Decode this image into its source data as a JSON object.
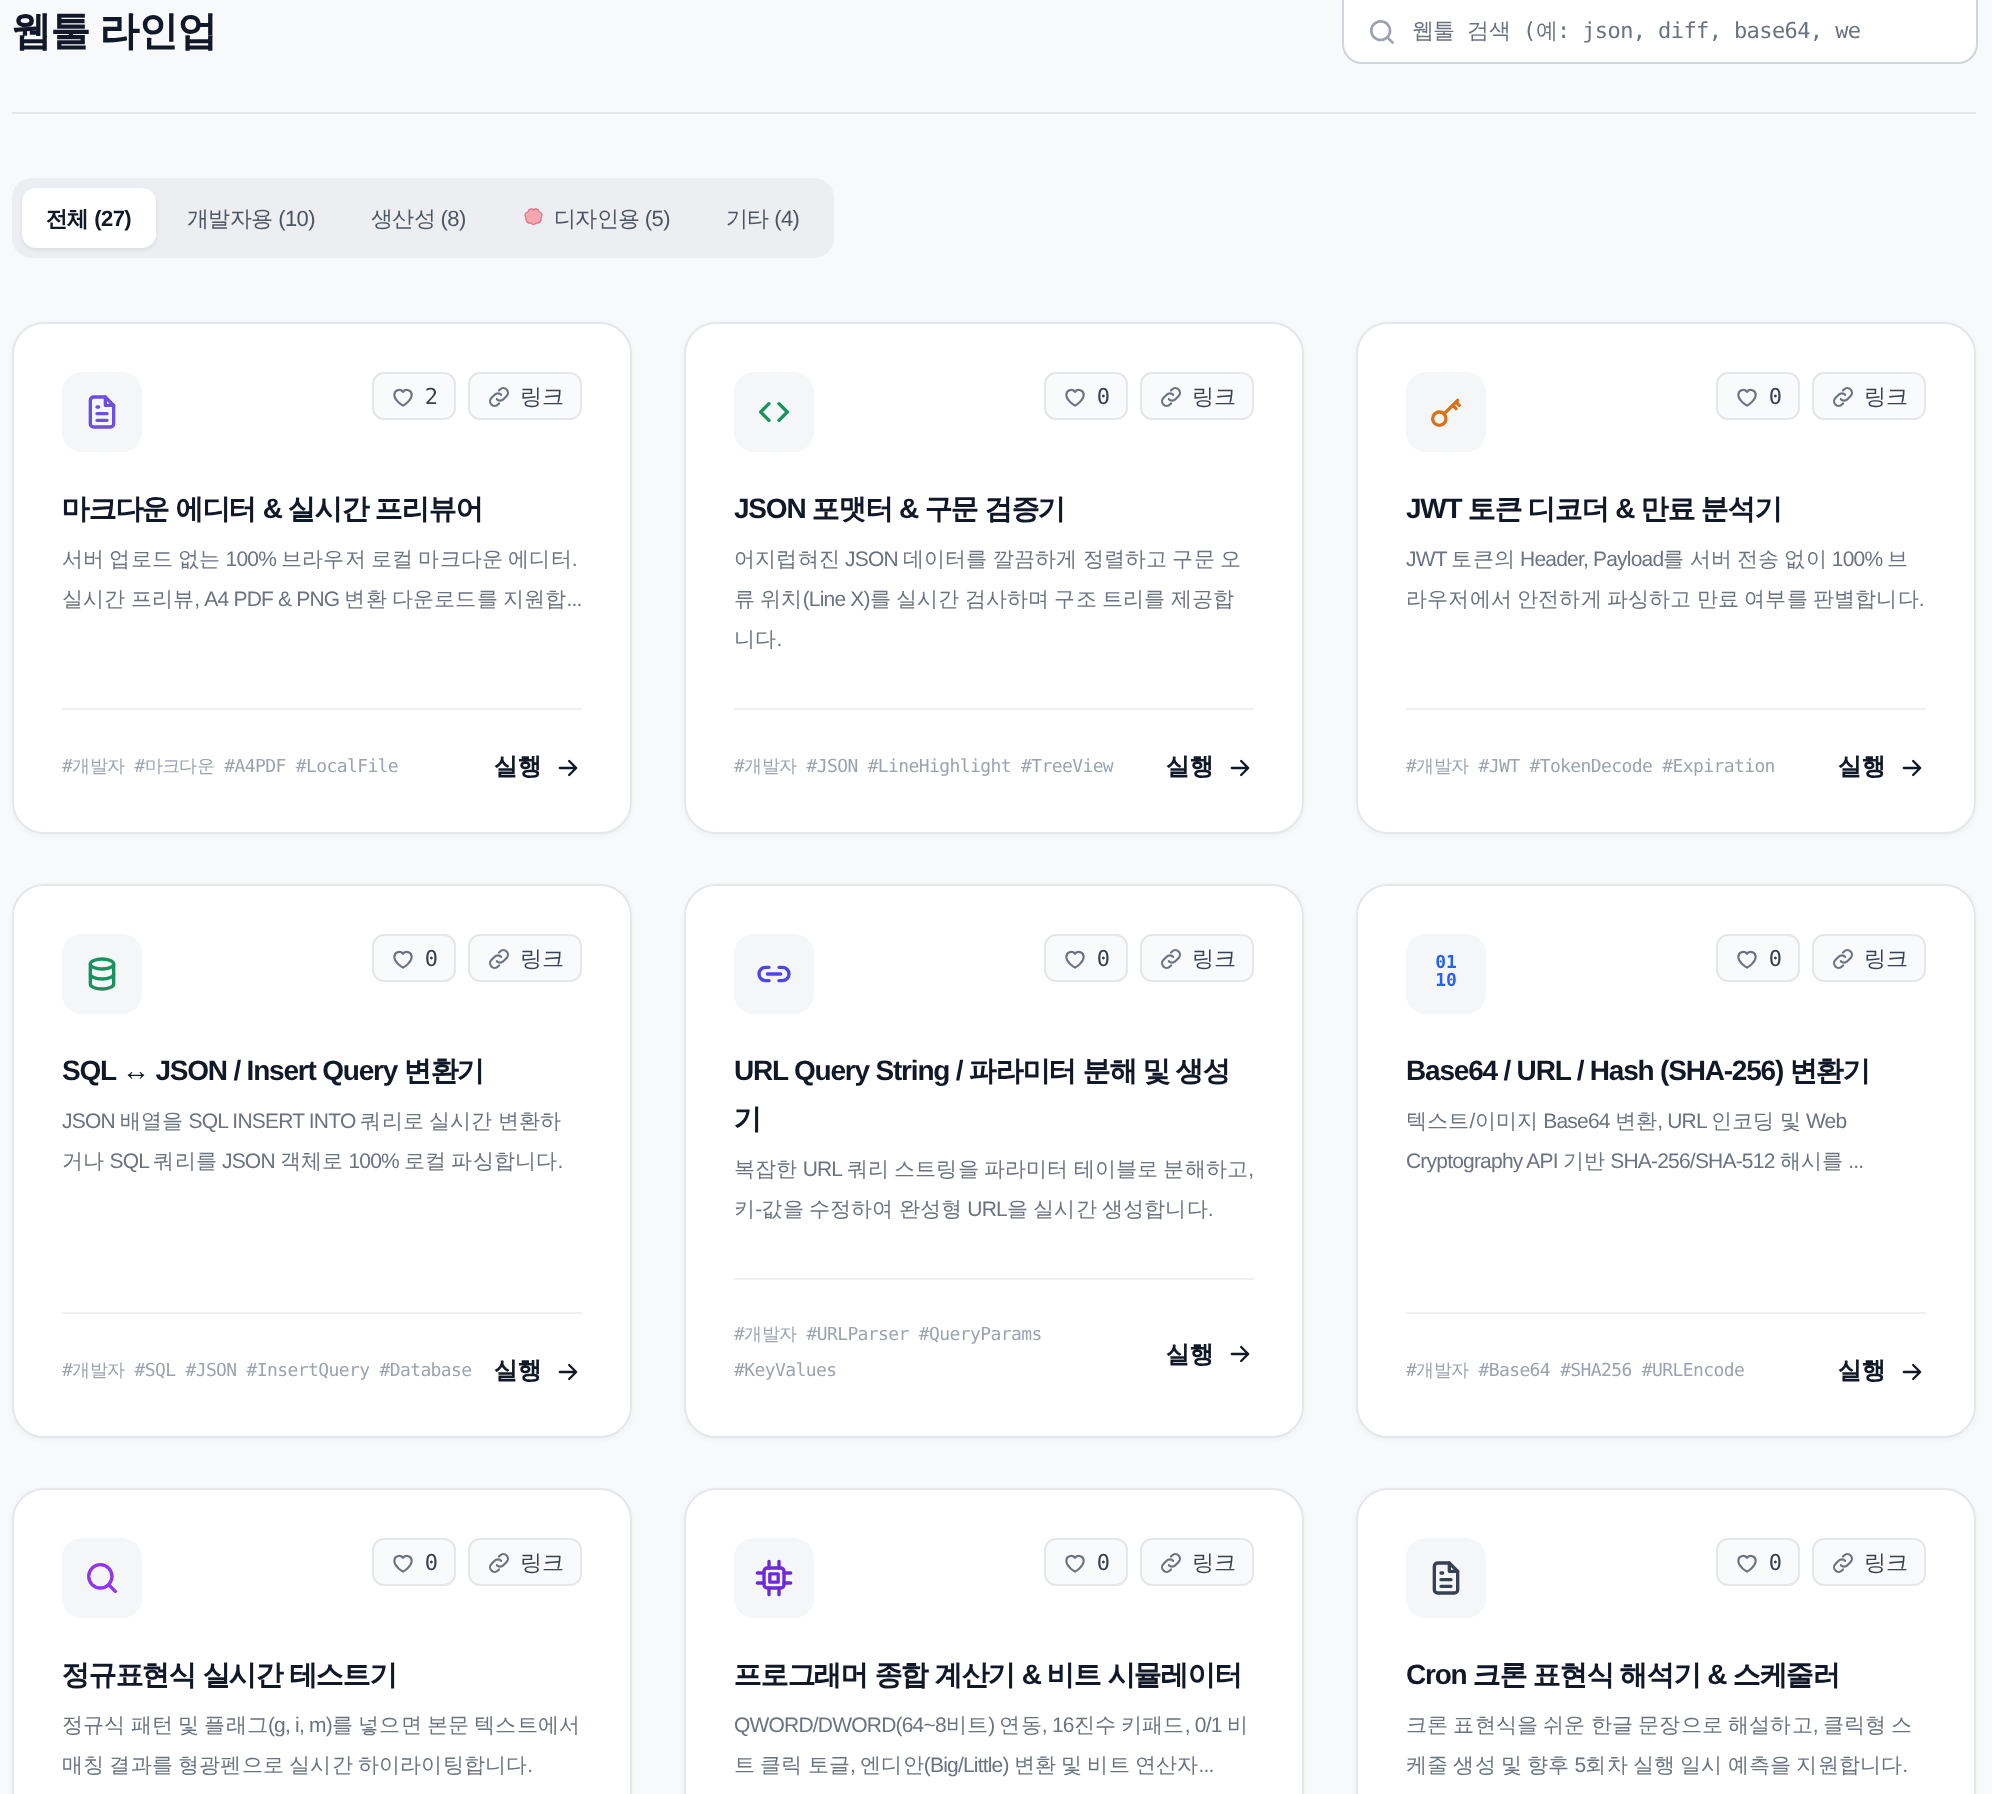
{
  "header": {
    "title": "웹툴 라인업",
    "search": {
      "placeholder": "웹툴 검색 (예: json, diff, base64, we"
    }
  },
  "tabs": [
    {
      "label": "전체 (27)",
      "selected": true
    },
    {
      "label": "개발자용 (10)",
      "selected": false
    },
    {
      "label": "생산성 (8)",
      "selected": false
    },
    {
      "label": "디자인용 (5)",
      "selected": false,
      "icon": true
    },
    {
      "label": "기타 (4)",
      "selected": false
    }
  ],
  "cards": [
    {
      "kind": "document",
      "color": "#6d4fe0",
      "likes": "2",
      "link": "링크",
      "title": "마크다운 에디터 & 실시간 프리뷰어",
      "description": "서버 업로드 없는 100% 브라우저 로컬 마크다운 에디터. 실시간 프리뷰, A4 PDF & PNG 변환 다운로드를 지원합...",
      "tags": [
        "#개발자",
        "#마크다운",
        "#A4PDF",
        "#LocalFile"
      ],
      "action": "실행"
    },
    {
      "kind": "code",
      "color": "#17935f",
      "likes": "0",
      "link": "링크",
      "title": "JSON 포맷터 & 구문 검증기",
      "description": "어지럽혀진 JSON 데이터를 깔끔하게 정렬하고 구문 오류 위치(Line X)를 실시간 검사하며 구조 트리를 제공합니다.",
      "tags": [
        "#개발자",
        "#JSON",
        "#LineHighlight",
        "#TreeView"
      ],
      "action": "실행"
    },
    {
      "kind": "key",
      "color": "#d9701a",
      "likes": "0",
      "link": "링크",
      "title": "JWT 토큰 디코더 & 만료 분석기",
      "description": "JWT 토큰의 Header, Payload를 서버 전송 없이 100% 브라우저에서 안전하게 파싱하고 만료 여부를 판별합니다.",
      "tags": [
        "#개발자",
        "#JWT",
        "#TokenDecode",
        "#Expiration"
      ],
      "action": "실행"
    },
    {
      "kind": "database",
      "color": "#17935f",
      "likes": "0",
      "link": "링크",
      "title": "SQL ↔ JSON / Insert Query 변환기",
      "description": "JSON 배열을 SQL INSERT INTO 쿼리로 실시간 변환하거나 SQL 쿼리를 JSON 객체로 100% 로컬 파싱합니다.",
      "tags": [
        "#개발자",
        "#SQL",
        "#JSON",
        "#InsertQuery",
        "#Database"
      ],
      "action": "실행"
    },
    {
      "kind": "link",
      "color": "#5046e5",
      "likes": "0",
      "link": "링크",
      "title": "URL Query String / 파라미터 분해 및 생성기",
      "description": "복잡한 URL 쿼리 스트링을 파라미터 테이블로 분해하고, 키-값을 수정하여 완성형 URL을 실시간 생성합니다.",
      "tags": [
        "#개발자",
        "#URLParser",
        "#QueryParams",
        "#KeyValues"
      ],
      "action": "실행"
    },
    {
      "kind": "binary",
      "color": "#2563eb",
      "icon_text": [
        "01",
        "10"
      ],
      "likes": "0",
      "link": "링크",
      "title": "Base64 / URL / Hash (SHA-256) 변환기",
      "description": "텍스트/이미지 Base64 변환, URL 인코딩 및 Web Cryptography API 기반 SHA-256/SHA-512 해시를 ...",
      "tags": [
        "#개발자",
        "#Base64",
        "#SHA256",
        "#URLEncode"
      ],
      "action": "실행"
    },
    {
      "kind": "search",
      "color": "#9333ea",
      "likes": "0",
      "link": "링크",
      "title": "정규표현식 실시간 테스트기",
      "description": "정규식 패턴 및 플래그(g, i, m)를 넣으면 본문 텍스트에서 매칭 결과를 형광펜으로 실시간 하이라이팅합니다."
    },
    {
      "kind": "chip",
      "color": "#6d28d9",
      "likes": "0",
      "link": "링크",
      "title": "프로그래머 종합 계산기 & 비트 시뮬레이터",
      "description": "QWORD/DWORD(64~8비트) 연동, 16진수 키패드, 0/1 비트 클릭 토글, 엔디안(Big/Little) 변환 및 비트 연산자..."
    },
    {
      "kind": "document",
      "color": "#374151",
      "likes": "0",
      "link": "링크",
      "title": "Cron 크론 표현식 해석기 & 스케줄러",
      "description": "크론 표현식을 쉬운 한글 문장으로 해설하고, 클릭형 스케줄 생성 및 향후 5회차 실행 일시 예측을 지원합니다."
    }
  ]
}
